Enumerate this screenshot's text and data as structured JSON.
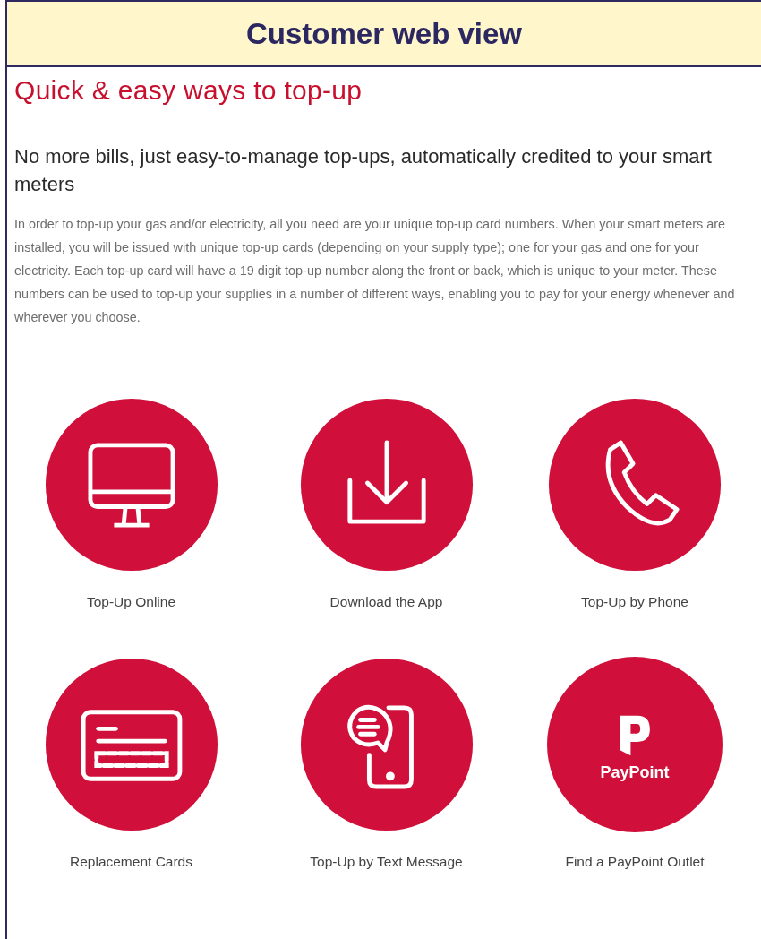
{
  "banner": {
    "title": "Customer web view"
  },
  "page": {
    "heading": "Quick & easy ways to top-up",
    "subheading": "No more bills, just easy-to-manage top-ups, automatically credited to your smart meters",
    "paragraph": "In order to top-up your gas and/or electricity, all you need are your unique top-up card numbers. When your smart meters are installed, you will be issued with unique top-up cards (depending on your supply type); one for your gas and one for your electricity. Each top-up card will have a 19 digit top-up number along the front or back, which is unique to your meter. These numbers can be used to top-up your supplies in a number of different ways, enabling you to pay for your energy whenever and wherever you choose."
  },
  "options": [
    {
      "kind": "monitor",
      "label": "Top-Up Online"
    },
    {
      "kind": "download",
      "label": "Download the App"
    },
    {
      "kind": "phone",
      "label": "Top-Up by Phone"
    },
    {
      "kind": "card",
      "label": "Replacement Cards"
    },
    {
      "kind": "message",
      "label": "Top-Up by Text Message"
    },
    {
      "kind": "paypoint",
      "label": "Find a PayPoint Outlet",
      "icon_text": "PayPoint"
    }
  ]
}
